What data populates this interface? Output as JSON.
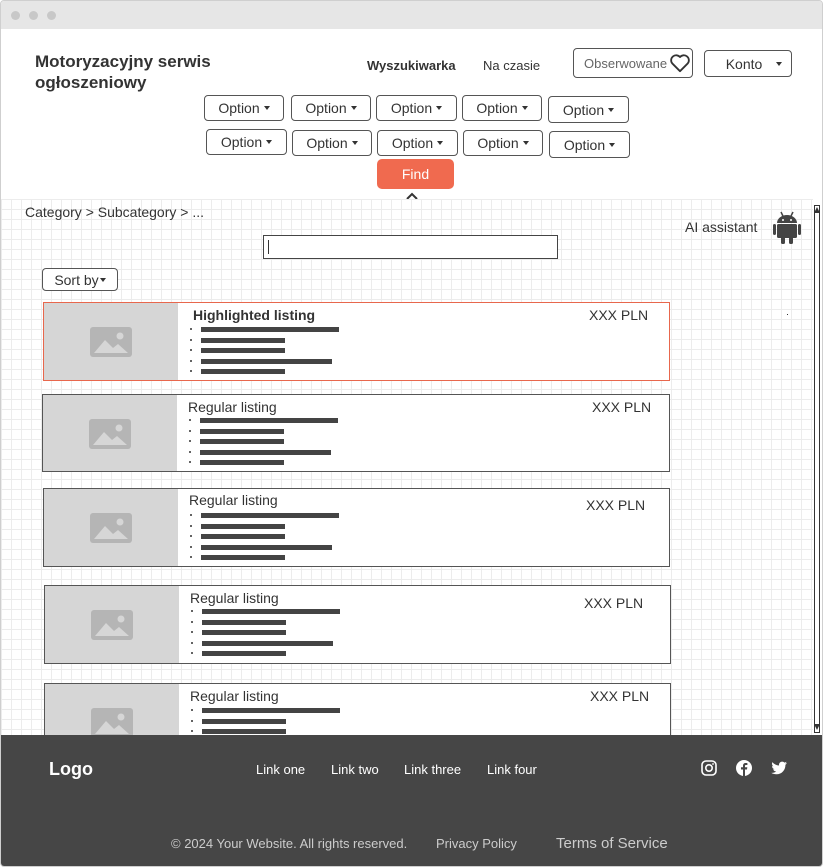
{
  "header": {
    "site_title": "Motoryzacyjny serwis ogłoszeniowy",
    "nav": {
      "search": "Wyszukiwarka",
      "trending": "Na czasie"
    },
    "watched_label": "Obserwowane",
    "account_label": "Konto",
    "filters_row1": [
      "Option",
      "Option",
      "Option",
      "Option",
      "Option"
    ],
    "filters_row2": [
      "Option",
      "Option",
      "Option",
      "Option",
      "Option"
    ],
    "find_label": "Find"
  },
  "content": {
    "breadcrumb": "Category > Subcategory > ...",
    "ai_assistant": "AI assistant",
    "search_value": "",
    "sort_label": "Sort by",
    "listings": [
      {
        "title": "Highlighted listing",
        "price": "XXX PLN"
      },
      {
        "title": "Regular listing",
        "price": "XXX PLN"
      },
      {
        "title": "Regular listing",
        "price": "XXX PLN"
      },
      {
        "title": "Regular listing",
        "price": "XXX PLN"
      },
      {
        "title": "Regular listing",
        "price": "XXX PLN"
      }
    ]
  },
  "footer": {
    "logo": "Logo",
    "links": [
      "Link one",
      "Link two",
      "Link three",
      "Link four"
    ],
    "copyright": "© 2024 Your Website. All rights reserved.",
    "privacy": "Privacy Policy",
    "terms": "Terms of Service"
  },
  "colors": {
    "accent": "#f06a4f",
    "footer_bg": "#464646",
    "thumb_bg": "#d6d6d6"
  },
  "icons": [
    "heart-icon",
    "android-icon",
    "image-placeholder-icon",
    "instagram-icon",
    "facebook-icon",
    "twitter-icon",
    "chevron-up-icon",
    "caret-down-icon"
  ]
}
